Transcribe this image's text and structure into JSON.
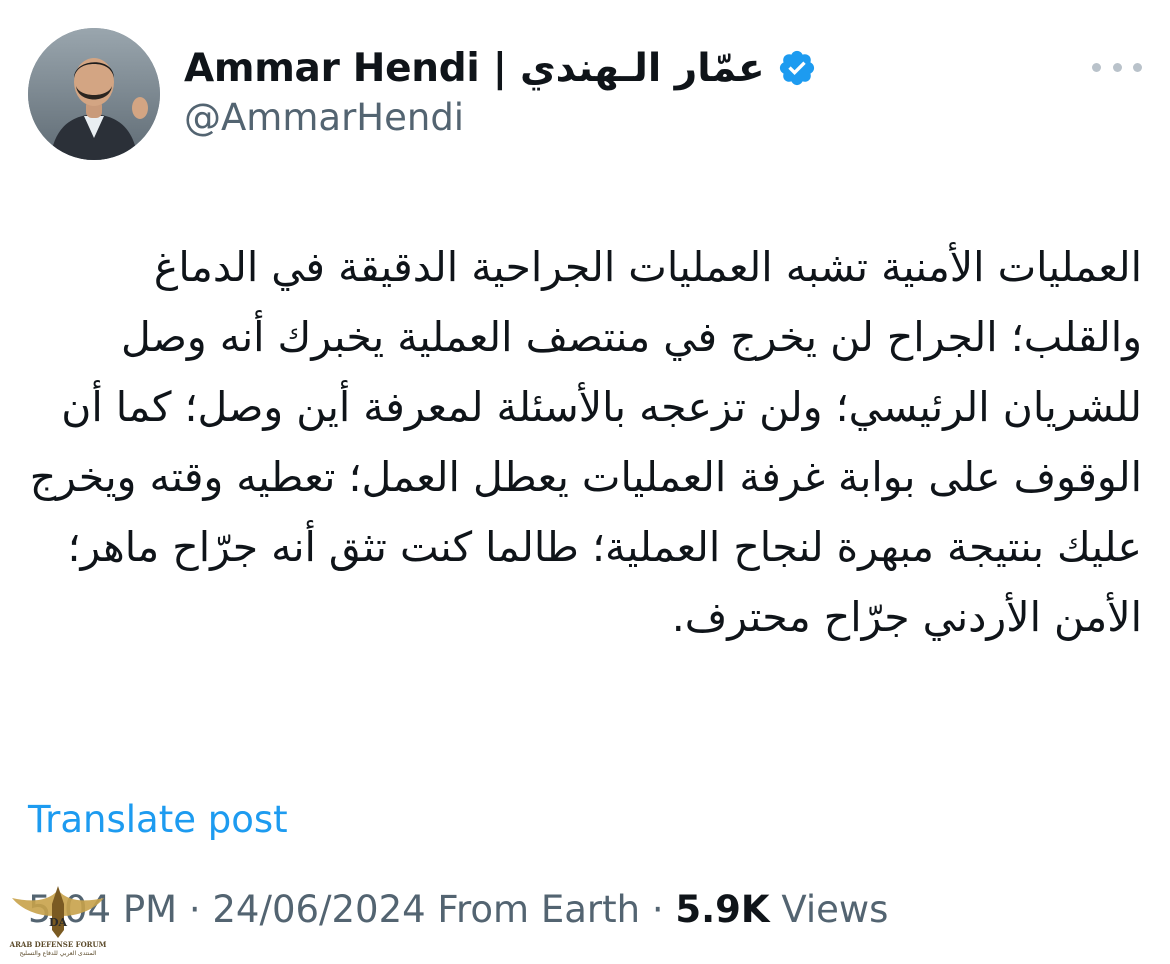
{
  "author": {
    "display_name": "Ammar Hendi | عمّار الـهندي",
    "handle": "@AmmarHendi",
    "avatar_icon": "profile-photo",
    "verified_icon": "verified-badge-icon",
    "verified_color": "#1d9bf0"
  },
  "menu": {
    "more_icon": "more-options-icon"
  },
  "post": {
    "text": "العمليات الأمنية تشبه العمليات الجراحية الدقيقة في الدماغ والقلب؛ الجراح لن يخرج في منتصف العملية يخبرك أنه وصل للشريان الرئيسي؛ ولن تزعجه بالأسئلة لمعرفة أين وصل؛ كما أن الوقوف على بوابة غرفة العمليات يعطل العمل؛ تعطيه وقته ويخرج عليك بنتيجة مبهرة لنجاح العملية؛ طالما كنت تثق أنه جرّاح ماهر؛ الأمن الأردني جرّاح محترف."
  },
  "translate_label": "Translate post",
  "meta": {
    "time": "5:04 PM",
    "separator": " · ",
    "date": "24/06/2024",
    "source": "From Earth",
    "views_count": "5.9K",
    "views_label": "Views"
  },
  "watermark": {
    "logo_text": "DA",
    "title": "ARAB DEFENSE FORUM",
    "subtitle": "المنتدى العربي للدفاع والتسليح"
  },
  "colors": {
    "text": "#0f1419",
    "secondary": "#536471",
    "link": "#1d9bf0"
  }
}
